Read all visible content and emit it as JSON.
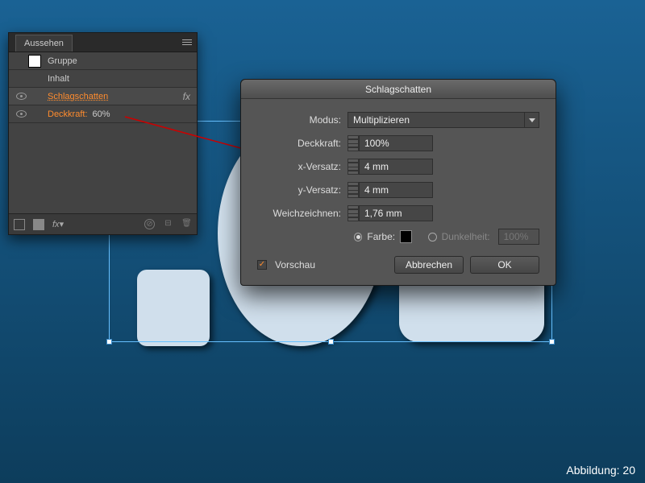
{
  "panel": {
    "title": "Aussehen",
    "rows": {
      "group": "Gruppe",
      "content": "Inhalt",
      "dropshadow": "Schlagschatten",
      "opacity_label": "Deckkraft:",
      "opacity_value": "60%"
    }
  },
  "dialog": {
    "title": "Schlagschatten",
    "labels": {
      "mode": "Modus:",
      "opacity": "Deckkraft:",
      "xoffset": "x-Versatz:",
      "yoffset": "y-Versatz:",
      "blur": "Weichzeichnen:",
      "color": "Farbe:",
      "darkness": "Dunkelheit:",
      "preview": "Vorschau"
    },
    "values": {
      "mode": "Multiplizieren",
      "opacity": "100%",
      "xoffset": "4 mm",
      "yoffset": "4 mm",
      "blur": "1,76 mm",
      "darkness": "100%"
    },
    "buttons": {
      "cancel": "Abbrechen",
      "ok": "OK"
    }
  },
  "caption": "Abbildung: 20"
}
